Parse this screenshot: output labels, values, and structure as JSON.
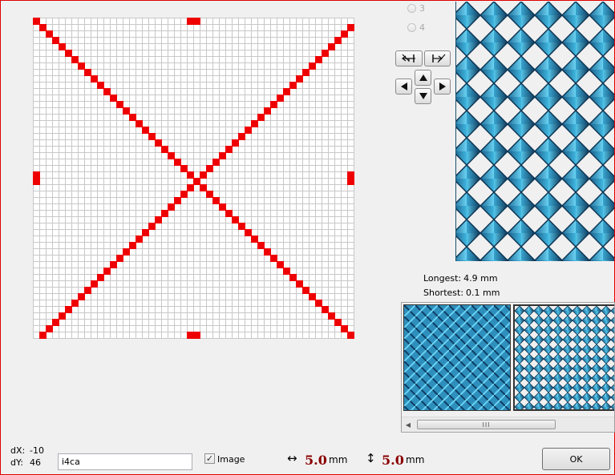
{
  "radio_options": [
    {
      "label": "3",
      "selected": false
    },
    {
      "label": "4",
      "selected": false
    }
  ],
  "tools": {
    "align_left": {
      "icon": "align-left-arrow-icon"
    },
    "align_right": {
      "icon": "align-right-arrow-icon"
    },
    "move_up": {
      "icon": "arrow-up-icon"
    },
    "move_down": {
      "icon": "arrow-down-icon"
    },
    "move_left": {
      "icon": "arrow-left-icon"
    },
    "move_right": {
      "icon": "arrow-right-icon"
    }
  },
  "info": {
    "longest_label": "Longest:",
    "longest_value": "4.9 mm",
    "shortest_label": "Shortest:",
    "shortest_value": "0.1 mm"
  },
  "coords": {
    "dx_label": "dX:",
    "dx_value": "-10",
    "dy_label": "dY:",
    "dy_value": "46"
  },
  "name_field": {
    "value": "i4ca"
  },
  "image_checkbox": {
    "label": "Image",
    "checked": true
  },
  "width": {
    "icon": "horizontal-arrow-icon",
    "value": "5.0",
    "unit": "mm"
  },
  "height": {
    "icon": "vertical-arrow-icon",
    "value": "5.0",
    "unit": "mm"
  },
  "ok_button": {
    "label": "OK"
  },
  "scrollbar": {
    "grip": "III"
  },
  "colors": {
    "stitch": "#ee0000",
    "grid_line": "#c8c8c8",
    "pattern_light": "#4fc3e6",
    "pattern_dark": "#0f3d62",
    "dimension_value": "#8b0000"
  }
}
